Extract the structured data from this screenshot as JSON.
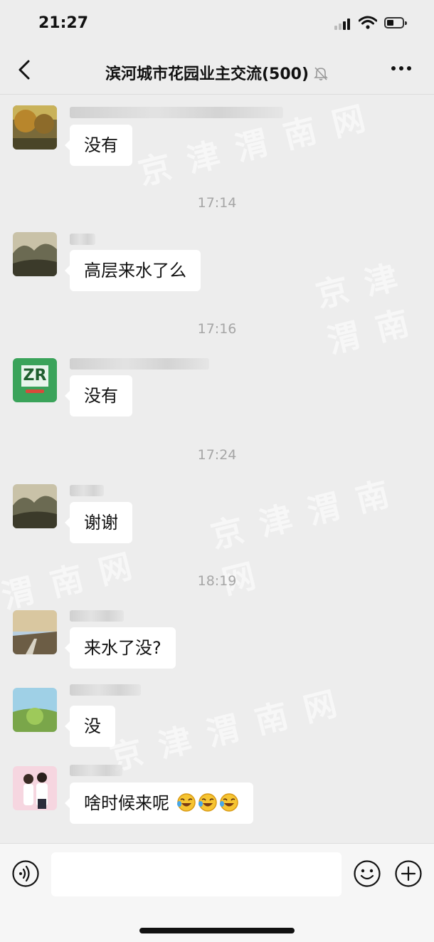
{
  "status": {
    "time": "21:27"
  },
  "chat": {
    "title": "滨河城市花园业主交流(500)"
  },
  "messages": [
    {
      "text": "没有"
    },
    {
      "time": "17:14",
      "text": "高层来水了么"
    },
    {
      "time": "17:16",
      "text": "没有",
      "avatar_text": "ZR"
    },
    {
      "time": "17:24",
      "text": "谢谢"
    },
    {
      "time": "18:19",
      "text": "来水了没?"
    },
    {
      "text": "没"
    },
    {
      "text": "啥时候来呢"
    }
  ],
  "icons": {
    "back": "chevron-left-icon",
    "mute": "bell-off-icon",
    "more": "more-dots-icon",
    "voice": "voice-icon",
    "emoji": "smile-icon",
    "plus": "plus-icon"
  },
  "colors": {
    "background": "#ededed",
    "bubble": "#ffffff",
    "input_bar": "#f6f6f6"
  }
}
